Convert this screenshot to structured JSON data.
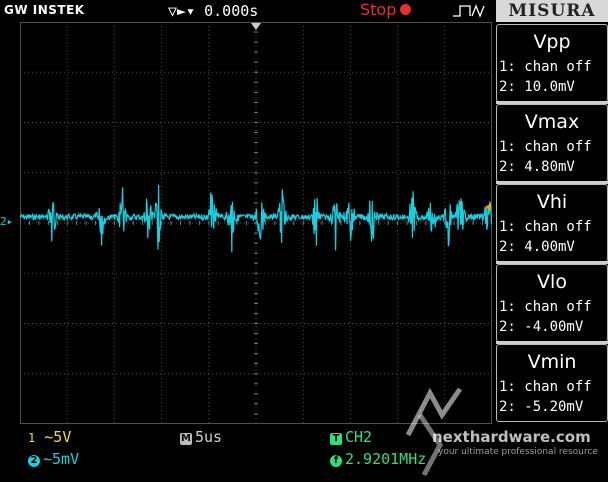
{
  "header": {
    "brand": "GW INSTEK",
    "trigger_delay": "0.000s",
    "run_status": "Stop",
    "menu_title": "MISURA"
  },
  "measurements": [
    {
      "name": "Vpp",
      "ch1": "1: chan off",
      "ch2": "2: 10.0mV"
    },
    {
      "name": "Vmax",
      "ch1": "1: chan off",
      "ch2": "2: 4.80mV"
    },
    {
      "name": "Vhi",
      "ch1": "1: chan off",
      "ch2": "2: 4.00mV"
    },
    {
      "name": "Vlo",
      "ch1": "1: chan off",
      "ch2": "2: -4.00mV"
    },
    {
      "name": "Vmin",
      "ch1": "1: chan off",
      "ch2": "2: -5.20mV"
    }
  ],
  "footer": {
    "ch1_scale": "~5V",
    "ch2_scale": "~5mV",
    "timebase": "5us",
    "trigger_source": "CH2",
    "frequency": "2.9201MHz"
  },
  "markers": {
    "ch2_label": "2"
  },
  "watermark": {
    "title": "nexthardware.com",
    "subtitle": "your ultimate professional resource"
  },
  "colors": {
    "ch1": "#f0e020",
    "ch2": "#18d0e0",
    "stop": "#e53030",
    "grid": "#5a5a5a",
    "panel_bg": "#d8d8d8"
  }
}
